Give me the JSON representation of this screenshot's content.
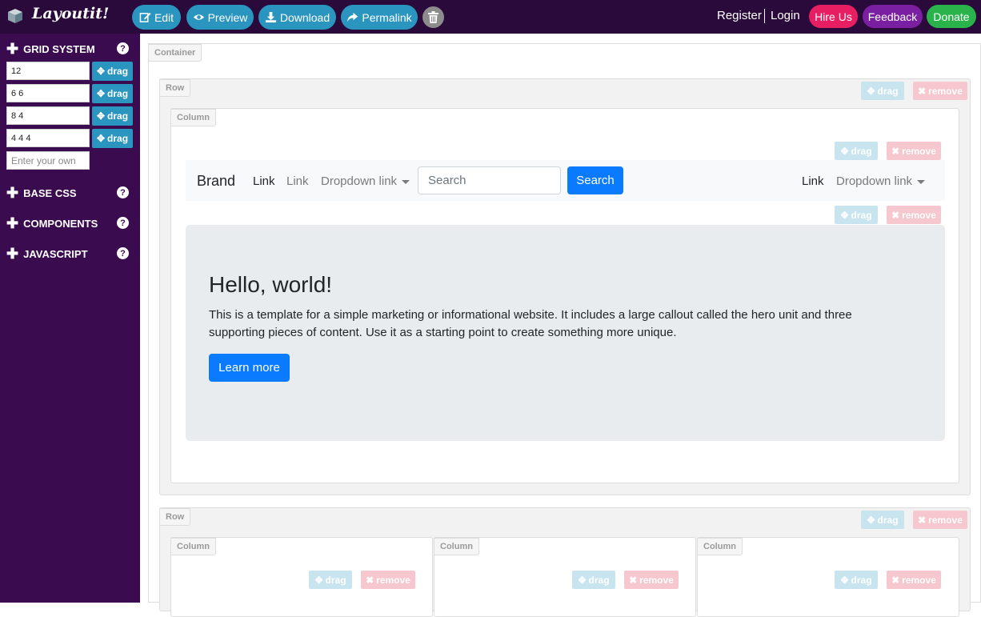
{
  "app": {
    "title": "Layoutit!"
  },
  "toolbar": {
    "edit": "Edit",
    "preview": "Preview",
    "download": "Download",
    "permalink": "Permalink"
  },
  "auth": {
    "register": "Register",
    "login": "Login"
  },
  "actions": {
    "hire": "Hire Us",
    "feedback": "Feedback",
    "donate": "Donate"
  },
  "colors": {
    "topbar": "#2a0a3b",
    "sidebar": "#3b0b4f",
    "toolbar_button": "#2a95bf",
    "hire": "#e81e63",
    "feedback": "#7b1fa2",
    "donate": "#2ab34b",
    "primary": "#0a7bff"
  },
  "sidebar": {
    "grid_system": "GRID SYSTEM",
    "base_css": "BASE CSS",
    "components": "COMPONENTS",
    "javascript": "JAVASCRIPT",
    "help": "?",
    "grid_rows": [
      {
        "value": "12",
        "drag": "drag"
      },
      {
        "value": "6 6",
        "drag": "drag"
      },
      {
        "value": "8 4",
        "drag": "drag"
      },
      {
        "value": "4 4 4",
        "drag": "drag"
      }
    ],
    "custom_placeholder": "Enter your own"
  },
  "canvas": {
    "container_label": "Container",
    "row_label": "Row",
    "column_label": "Column",
    "drag": "drag",
    "remove": "remove"
  },
  "navbar_demo": {
    "brand": "Brand",
    "link1": "Link",
    "link2": "Link",
    "dropdown": "Dropdown link",
    "search_placeholder": "Search",
    "search_button": "Search",
    "right_link": "Link",
    "right_dropdown": "Dropdown link"
  },
  "jumbotron": {
    "title": "Hello, world!",
    "text": "This is a template for a simple marketing or informational website. It includes a large callout called the hero unit and three supporting pieces of content. Use it as a starting point to create something more unique.",
    "button": "Learn more"
  }
}
